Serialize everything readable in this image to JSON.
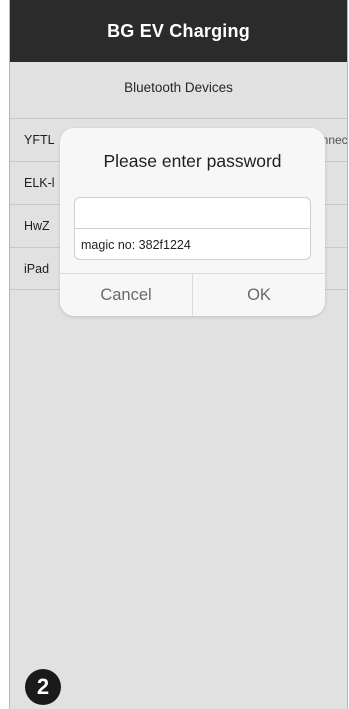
{
  "app": {
    "title": "BG EV Charging"
  },
  "section": {
    "title": "Bluetooth Devices"
  },
  "devices": [
    {
      "name": "YFTL",
      "action": "nnect"
    },
    {
      "name": "ELK-l",
      "action": ""
    },
    {
      "name": "HwZ",
      "action": ""
    },
    {
      "name": "iPad",
      "action": ""
    }
  ],
  "dialog": {
    "title": "Please enter password",
    "password_value": "",
    "password_placeholder": "",
    "magic_text": "magic no: 382f1224",
    "cancel_label": "Cancel",
    "ok_label": "OK"
  },
  "step_badge": "2",
  "colors": {
    "navbar": "#2b2b2b",
    "background": "#f3f3f3",
    "dialog": "#f7f7f7",
    "button_text": "#6a6a6a"
  }
}
